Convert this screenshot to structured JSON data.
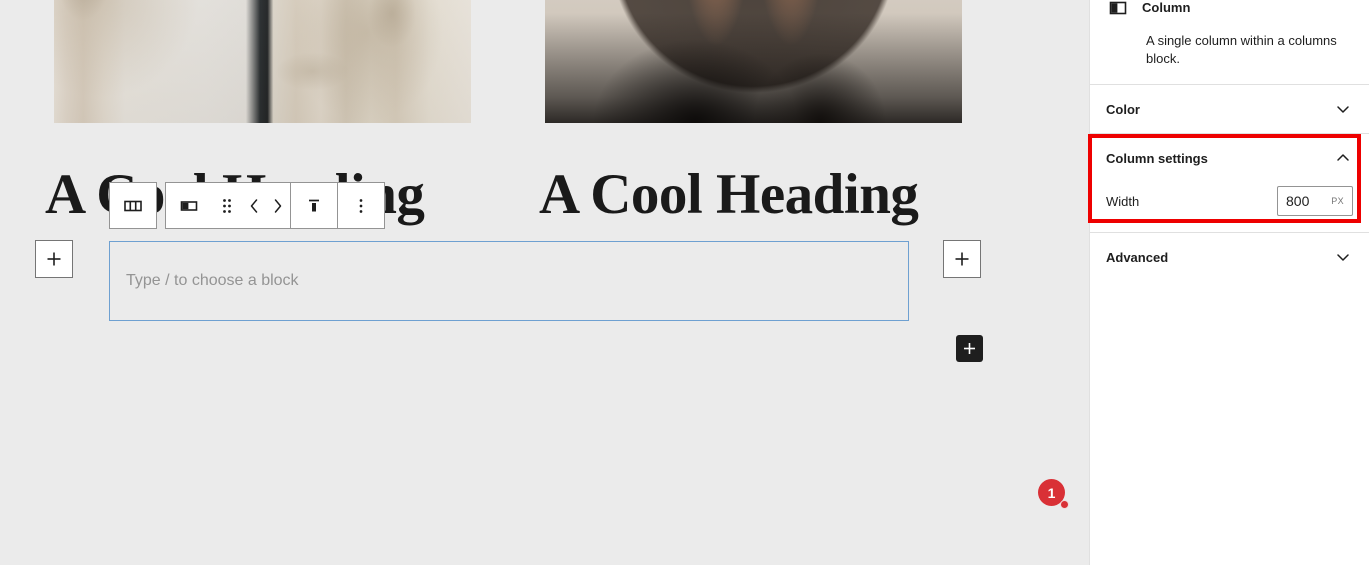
{
  "canvas": {
    "media": [
      {
        "name": "image-sweater",
        "alt": "Cream sweater sleeves on a pale background"
      },
      {
        "name": "image-laptop",
        "alt": "Hands typing on a laptop"
      }
    ],
    "headings": [
      {
        "text": "A Cool Heading"
      },
      {
        "text": "A Cool Heading"
      }
    ],
    "empty_block": {
      "placeholder": "Type / to choose a block"
    },
    "inserters": {
      "left_label": "+",
      "right_label": "+",
      "dark_label": "+"
    },
    "step_badge": {
      "number": "1",
      "color": "#d93036"
    }
  },
  "toolbar": {
    "items": [
      {
        "name": "select-parent-columns-button",
        "icon": "columns-icon",
        "label": "Select Columns"
      },
      {
        "name": "change-block-type-button",
        "icon": "column-icon",
        "label": "Column"
      },
      {
        "name": "drag-handle",
        "icon": "drag-dots-icon",
        "label": "Drag"
      },
      {
        "name": "move-left-button",
        "icon": "chevron-left-icon",
        "label": "Move left"
      },
      {
        "name": "move-right-button",
        "icon": "chevron-right-icon",
        "label": "Move right"
      },
      {
        "name": "vertical-align-button",
        "icon": "align-top-icon",
        "label": "Change vertical alignment"
      },
      {
        "name": "more-options-button",
        "icon": "more-vertical-icon",
        "label": "Options"
      }
    ]
  },
  "sidebar": {
    "block_card": {
      "icon": "column-icon",
      "title": "Column",
      "description": "A single column within a columns block."
    },
    "panels": [
      {
        "name": "color",
        "title": "Color",
        "expanded": false,
        "chevron": "chevron-down-icon"
      },
      {
        "name": "column-settings",
        "title": "Column settings",
        "expanded": true,
        "chevron": "chevron-up-icon"
      },
      {
        "name": "advanced",
        "title": "Advanced",
        "expanded": false,
        "chevron": "chevron-down-icon"
      }
    ],
    "column_settings": {
      "width_label": "Width",
      "width_value": "800",
      "width_unit": "PX"
    }
  },
  "annotation": {
    "highlight_color": "#ee0000"
  }
}
